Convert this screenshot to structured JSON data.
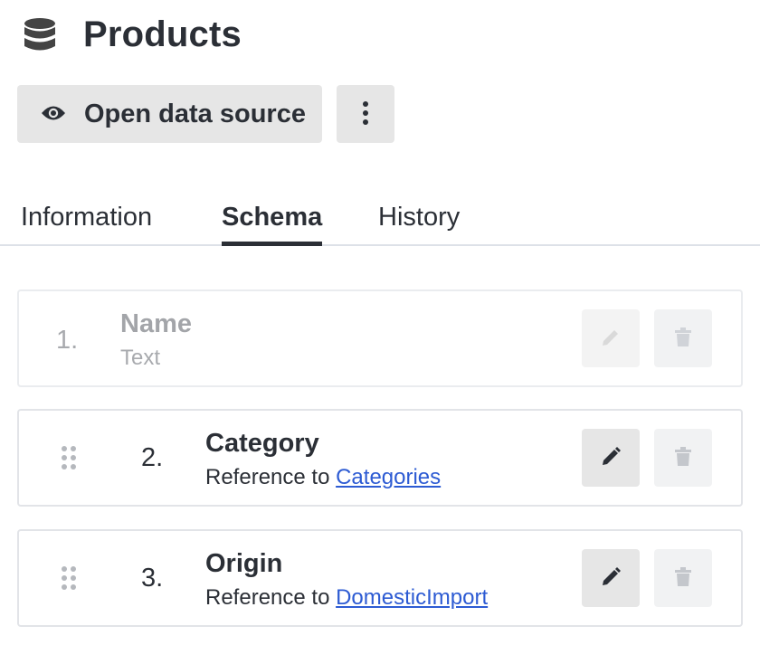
{
  "header": {
    "title": "Products",
    "icon": "database-icon"
  },
  "toolbar": {
    "open_label": "Open data source",
    "open_icon": "eye-icon",
    "more_icon": "kebab-menu-icon"
  },
  "tabs": [
    {
      "label": "Information",
      "active": false
    },
    {
      "label": "Schema",
      "active": true
    },
    {
      "label": "History",
      "active": false
    }
  ],
  "fields": [
    {
      "number": "1.",
      "name": "Name",
      "type_text": "Text",
      "reference": "",
      "disabled": true
    },
    {
      "number": "2.",
      "name": "Category",
      "type_text": "Reference to ",
      "reference": "Categories",
      "disabled": false
    },
    {
      "number": "3.",
      "name": "Origin",
      "type_text": "Reference to ",
      "reference": "DomesticImport",
      "disabled": false
    }
  ],
  "colors": {
    "text": "#2b2f36",
    "link": "#2d5bd3",
    "button_bg": "#e6e6e6",
    "disabled_text": "#a8aaae"
  }
}
